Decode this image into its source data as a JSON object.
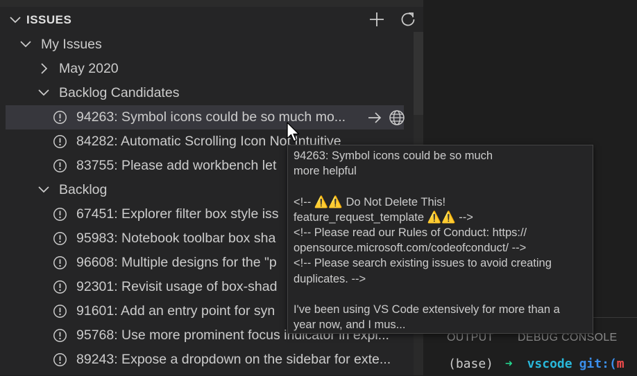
{
  "issues_view": {
    "title": "ISSUES",
    "actions": {
      "add_icon": "plus-icon",
      "refresh_icon": "refresh-icon"
    },
    "query": {
      "label": "My Issues",
      "expanded": true
    },
    "groups": [
      {
        "label": "May 2020",
        "expanded": false
      },
      {
        "label": "Backlog Candidates",
        "expanded": true,
        "issues": [
          {
            "text": "94263: Symbol icons could be so much mo...",
            "selected": true
          },
          {
            "text": "84282: Automatic Scrolling Icon Not Intuitive"
          },
          {
            "text": "83755: Please add workbench let"
          }
        ]
      },
      {
        "label": "Backlog",
        "expanded": true,
        "issues": [
          {
            "text": "67451: Explorer filter box style iss"
          },
          {
            "text": "95983: Notebook toolbar box sha"
          },
          {
            "text": "96608: Multiple designs for the \"p"
          },
          {
            "text": "92301: Revisit usage of box-shad"
          },
          {
            "text": "91601: Add an entry point for syn"
          },
          {
            "text": "95768: Use more prominent focus indicator in expl..."
          },
          {
            "text": "89243: Expose a dropdown on the sidebar for exte..."
          }
        ]
      }
    ],
    "row_actions": {
      "go_to_icon": "arrow-right-icon",
      "open_browser_icon": "globe-icon"
    }
  },
  "tooltip": {
    "lines": [
      "94263: Symbol icons could be so much",
      "more helpful",
      "",
      "<!-- ⚠️⚠️ Do Not Delete This!",
      "feature_request_template ⚠️⚠️ -->",
      "<!-- Please read our Rules of Conduct: https://",
      "opensource.microsoft.com/codeofconduct/ -->",
      "<!-- Please search existing issues to avoid creating",
      "duplicates. -->",
      "",
      "I've been using VS Code extensively for more than a",
      "year now, and I mus..."
    ]
  },
  "panel": {
    "tabs": [
      "OUTPUT",
      "DEBUG CONSOLE"
    ],
    "terminal": {
      "env": "(base)",
      "arrow": "➜",
      "dir": "vscode",
      "git": "git:(",
      "branch_start": "m"
    }
  },
  "colors": {
    "sidebar_bg": "#252526",
    "selected_row": "#37373d",
    "terminal_green": "#23d18b",
    "terminal_cyan": "#29b8db",
    "terminal_blue": "#3b8eea",
    "terminal_red": "#f14c4c"
  }
}
